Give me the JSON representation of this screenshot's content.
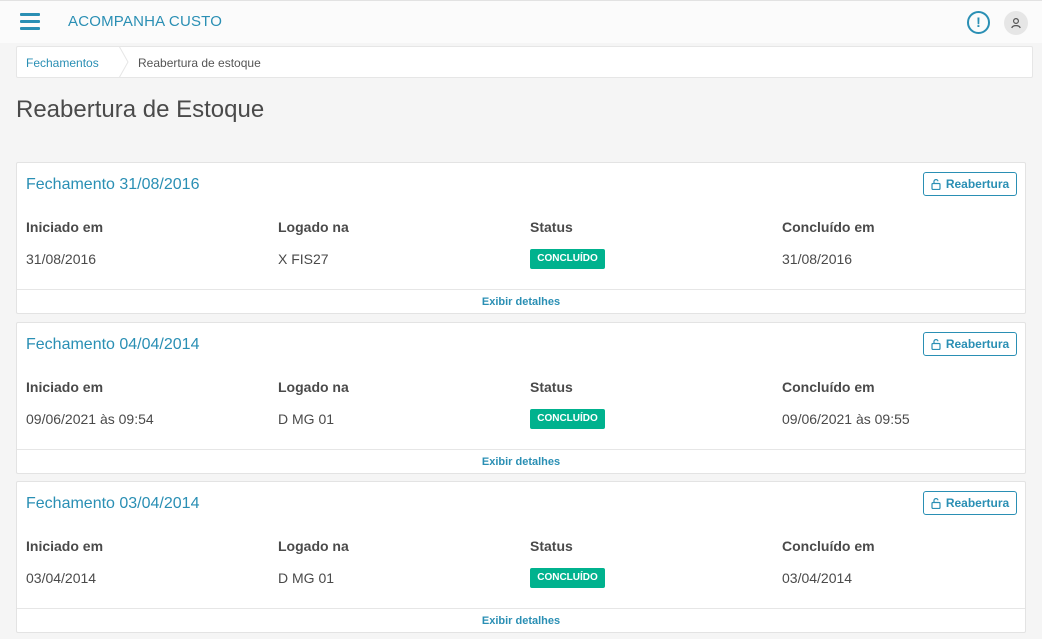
{
  "app": {
    "title": "ACOMPANHA CUSTO"
  },
  "header": {
    "menu_icon": "hamburger-menu-icon",
    "notification_icon": "exclamation-circle-icon",
    "notification_glyph": "!",
    "avatar_icon": "user-icon"
  },
  "breadcrumb": {
    "items": [
      "Fechamentos",
      "Reabertura de estoque"
    ]
  },
  "page": {
    "title": "Reabertura de Estoque"
  },
  "labels": {
    "started": "Iniciado em",
    "logged": "Logado na",
    "status": "Status",
    "completed": "Concluído em",
    "reopen_button": "Reabertura",
    "details_link": "Exibir detalhes"
  },
  "closings": [
    {
      "title": "Fechamento 31/08/2016",
      "started": "31/08/2016",
      "logged": "X FIS27",
      "status": "CONCLUÍDO",
      "completed": "31/08/2016"
    },
    {
      "title": "Fechamento 04/04/2014",
      "started": "09/06/2021 às 09:54",
      "logged": "D MG 01",
      "status": "CONCLUÍDO",
      "completed": "09/06/2021 às 09:55"
    },
    {
      "title": "Fechamento 03/04/2014",
      "started": "03/04/2014",
      "logged": "D MG 01",
      "status": "CONCLUÍDO",
      "completed": "03/04/2014"
    }
  ],
  "colors": {
    "accent": "#2a8fb4",
    "status_done": "#00b28e",
    "background": "#f5f5f5"
  }
}
